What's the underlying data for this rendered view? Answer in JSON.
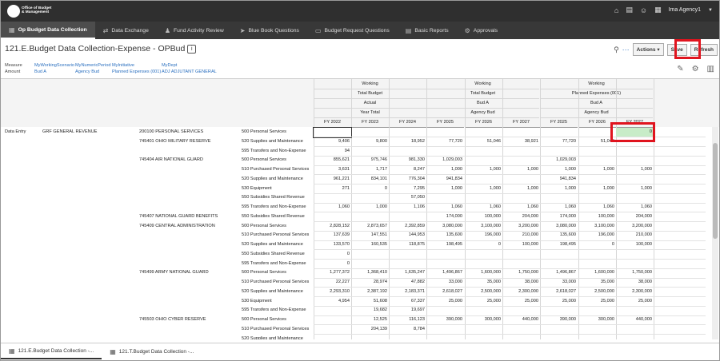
{
  "header": {
    "logo_line1": "Office of Budget",
    "logo_line2": "& Management",
    "user": "Ima Agency1"
  },
  "nav": [
    {
      "label": "Op Budget Data Collection",
      "icon": "grid-icon",
      "active": true
    },
    {
      "label": "Data Exchange",
      "icon": "exchange-icon"
    },
    {
      "label": "Fund Activity Review",
      "icon": "person-icon"
    },
    {
      "label": "Blue Book Questions",
      "icon": "arrow-icon"
    },
    {
      "label": "Budget Request Questions",
      "icon": "card-icon"
    },
    {
      "label": "Basic Reports",
      "icon": "report-icon"
    },
    {
      "label": "Approvals",
      "icon": "gear-icon"
    }
  ],
  "page": {
    "title": "121.E.Budget Data Collection-Expense - OPBud",
    "actions": "Actions",
    "save": "Save",
    "refresh": "Refresh"
  },
  "pov": {
    "measure_label": "Measure",
    "measure_value": "Amount",
    "scenario_label": "MyWorkingScenario",
    "scenario_value": "Bud A",
    "period_label": "MyNumericPeriod",
    "period_value": "Agency Bud",
    "init_label": "MyInitiative",
    "init_value": "Planned Expenses (001)",
    "dept_label": "MyDept",
    "dept_value": "ADJ ADJUTANT GENERAL"
  },
  "col_groups": [
    {
      "l1": "Working",
      "l2": "Total Budget",
      "l3": "Actual",
      "l4": "Year Total"
    },
    {
      "l1": "Working",
      "l2": "Total Budget",
      "l3": "Bud A",
      "l4": "Agency Bud"
    },
    {
      "l1": "Working",
      "l2": "Planned Expenses (001)",
      "l3": "Bud A",
      "l4": "Agency Bud"
    }
  ],
  "years": [
    "FY 2022",
    "FY 2023",
    "FY 2024",
    "FY 2025",
    "FY 2026",
    "FY 2027",
    "FY 2025",
    "FY 2026",
    "FY 2027"
  ],
  "row_header": {
    "entry": "Data Entry",
    "fund": "GRF GENERAL REVENUE"
  },
  "rows": [
    {
      "prog": "200100 PERSONAL SERVICES",
      "acct": "500 Personal Services",
      "v": [
        "",
        "",
        "",
        "",
        "",
        "",
        "",
        "",
        "0"
      ]
    },
    {
      "prog": "745401 OHIO MILITARY RESERVE",
      "acct": "520 Supplies and Maintenance",
      "v": [
        "9,406",
        "9,800",
        "18,952",
        "77,720",
        "51,046",
        "38,921",
        "77,720",
        "51,046",
        ""
      ]
    },
    {
      "prog": "",
      "acct": "595 Transfers and Non-Expense",
      "v": [
        "94",
        "",
        "",
        "",
        "",
        "",
        "",
        "",
        ""
      ]
    },
    {
      "prog": "745404 AIR NATIONAL GUARD",
      "acct": "500 Personal Services",
      "v": [
        "855,621",
        "975,746",
        "981,330",
        "1,029,003",
        "",
        "",
        "1,029,003",
        "",
        ""
      ]
    },
    {
      "prog": "",
      "acct": "510 Purchased Personal Services",
      "v": [
        "3,631",
        "1,717",
        "8,247",
        "1,000",
        "1,000",
        "1,000",
        "1,000",
        "1,000",
        "1,000"
      ]
    },
    {
      "prog": "",
      "acct": "520 Supplies and Maintenance",
      "v": [
        "961,221",
        "834,101",
        "776,304",
        "941,834",
        "",
        "",
        "941,834",
        "",
        ""
      ]
    },
    {
      "prog": "",
      "acct": "530 Equipment",
      "v": [
        "271",
        "0",
        "7,295",
        "1,000",
        "1,000",
        "1,000",
        "1,000",
        "1,000",
        "1,000"
      ]
    },
    {
      "prog": "",
      "acct": "550 Subsidies Shared Revenue",
      "v": [
        "",
        "",
        "57,050",
        "",
        "",
        "",
        "",
        "",
        ""
      ]
    },
    {
      "prog": "",
      "acct": "595 Transfers and Non-Expense",
      "v": [
        "1,060",
        "1,000",
        "1,106",
        "1,060",
        "1,060",
        "1,060",
        "1,060",
        "1,060",
        "1,060"
      ]
    },
    {
      "prog": "745407 NATIONAL GUARD BENEFITS",
      "acct": "550 Subsidies Shared Revenue",
      "v": [
        "",
        "",
        "",
        "174,000",
        "100,000",
        "204,000",
        "174,000",
        "100,000",
        "204,000"
      ]
    },
    {
      "prog": "745409 CENTRAL ADMINISTRATION",
      "acct": "500 Personal Services",
      "v": [
        "2,828,152",
        "2,873,657",
        "2,392,859",
        "3,080,000",
        "3,100,000",
        "3,200,000",
        "3,080,000",
        "3,100,000",
        "3,200,000"
      ]
    },
    {
      "prog": "",
      "acct": "510 Purchased Personal Services",
      "v": [
        "137,639",
        "147,551",
        "144,953",
        "135,600",
        "196,000",
        "210,000",
        "135,600",
        "196,000",
        "210,000"
      ]
    },
    {
      "prog": "",
      "acct": "520 Supplies and Maintenance",
      "v": [
        "133,570",
        "160,535",
        "118,875",
        "198,495",
        "0",
        "100,000",
        "198,495",
        "0",
        "100,000"
      ]
    },
    {
      "prog": "",
      "acct": "550 Subsidies Shared Revenue",
      "v": [
        "0",
        "",
        "",
        "",
        "",
        "",
        "",
        "",
        ""
      ]
    },
    {
      "prog": "",
      "acct": "595 Transfers and Non-Expense",
      "v": [
        "0",
        "",
        "",
        "",
        "",
        "",
        "",
        "",
        ""
      ]
    },
    {
      "prog": "745499 ARMY NATIONAL GUARD",
      "acct": "500 Personal Services",
      "v": [
        "1,277,372",
        "1,368,410",
        "1,635,247",
        "1,496,867",
        "1,600,000",
        "1,750,000",
        "1,496,867",
        "1,600,000",
        "1,750,000"
      ]
    },
    {
      "prog": "",
      "acct": "510 Purchased Personal Services",
      "v": [
        "22,227",
        "28,974",
        "47,882",
        "33,000",
        "35,000",
        "38,000",
        "33,000",
        "35,000",
        "38,000"
      ]
    },
    {
      "prog": "",
      "acct": "520 Supplies and Maintenance",
      "v": [
        "2,293,310",
        "2,387,192",
        "2,183,371",
        "2,618,027",
        "2,500,000",
        "2,300,000",
        "2,618,027",
        "2,500,000",
        "2,300,000"
      ]
    },
    {
      "prog": "",
      "acct": "530 Equipment",
      "v": [
        "4,954",
        "51,608",
        "67,337",
        "25,000",
        "25,000",
        "25,000",
        "25,000",
        "25,000",
        "25,000"
      ]
    },
    {
      "prog": "",
      "acct": "595 Transfers and Non-Expense",
      "v": [
        "",
        "19,682",
        "19,697",
        "",
        "",
        "",
        "",
        "",
        ""
      ]
    },
    {
      "prog": "745503 OHIO CYBER RESERVE",
      "acct": "500 Personal Services",
      "v": [
        "",
        "12,525",
        "116,123",
        "390,000",
        "300,000",
        "440,000",
        "390,000",
        "300,000",
        "440,000"
      ]
    },
    {
      "prog": "",
      "acct": "510 Purchased Personal Services",
      "v": [
        "",
        "204,139",
        "8,784",
        "",
        "",
        "",
        "",
        "",
        ""
      ]
    },
    {
      "prog": "",
      "acct": "520 Supplies and Maintenance",
      "v": [
        "",
        "",
        "",
        "",
        "",
        "",
        "",
        "",
        ""
      ]
    }
  ],
  "bottom_tabs": [
    {
      "label": "121.E.Budget Data Collection -...",
      "active": true
    },
    {
      "label": "121.T.Budget Data Collection -...",
      "active": false
    }
  ]
}
